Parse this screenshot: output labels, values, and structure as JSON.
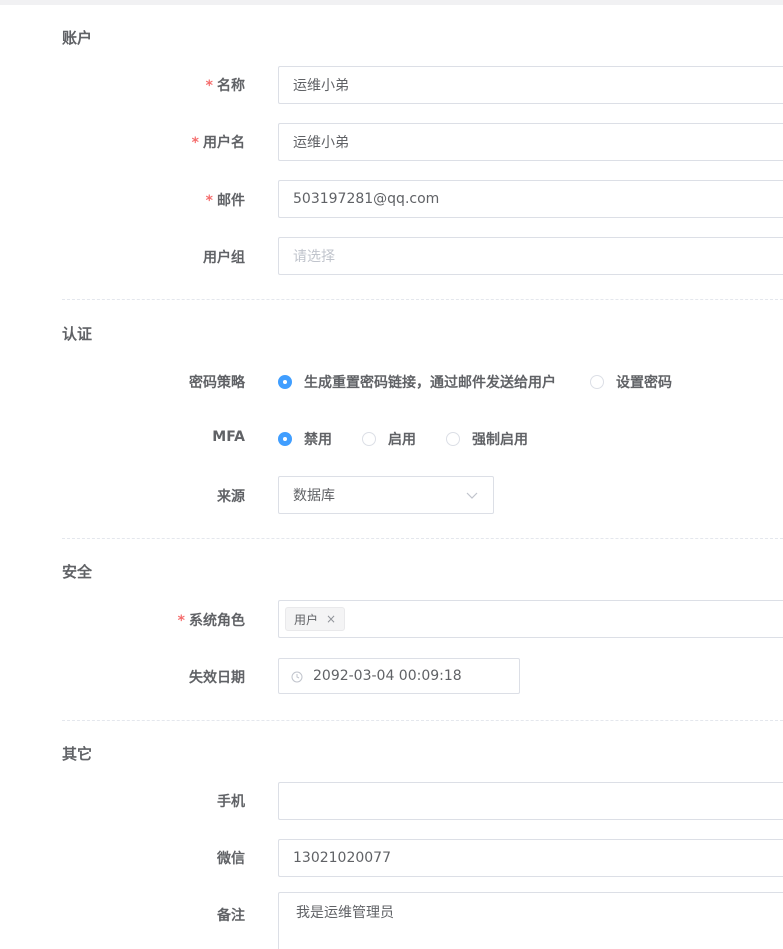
{
  "sections": {
    "account": "账户",
    "auth": "认证",
    "security": "安全",
    "other": "其它"
  },
  "required_mark": "*",
  "fields": {
    "name": {
      "label": "名称",
      "value": "运维小弟",
      "required": true
    },
    "username": {
      "label": "用户名",
      "value": "运维小弟",
      "required": true
    },
    "email": {
      "label": "邮件",
      "value": "503197281@qq.com",
      "required": true
    },
    "groups": {
      "label": "用户组",
      "value": "",
      "placeholder": "请选择"
    },
    "password_strategy": {
      "label": "密码策略",
      "options": [
        "生成重置密码链接，通过邮件发送给用户",
        "设置密码"
      ],
      "selected": 0
    },
    "mfa": {
      "label": "MFA",
      "options": [
        "禁用",
        "启用",
        "强制启用"
      ],
      "selected": 0
    },
    "source": {
      "label": "来源",
      "value": "数据库",
      "icon": "chevron-down-icon"
    },
    "system_roles": {
      "label": "系统角色",
      "required": true,
      "tags": [
        "用户"
      ],
      "tag_close": "×"
    },
    "expire_date": {
      "label": "失效日期",
      "value": "2092-03-04 00:09:18",
      "icon": "clock-icon"
    },
    "phone": {
      "label": "手机",
      "value": ""
    },
    "wechat": {
      "label": "微信",
      "value": "13021020077"
    },
    "comment": {
      "label": "备注",
      "value": "我是运维管理员"
    }
  },
  "colors": {
    "accent": "#409eff",
    "required": "#f56c6c",
    "border": "#dcdfe6",
    "text": "#606266",
    "placeholder": "#c0c4cc"
  }
}
